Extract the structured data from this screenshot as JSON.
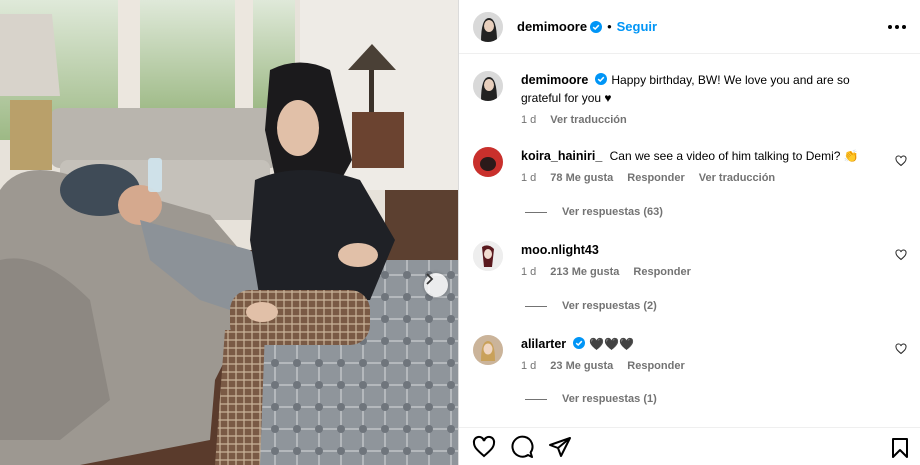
{
  "post": {
    "author": "demimoore",
    "follow_label": "Seguir",
    "separator": "•",
    "caption_text": "Happy birthday, BW! We love you and are so grateful for you ♥",
    "caption_time": "1 d",
    "caption_translate": "Ver traducción"
  },
  "comments": [
    {
      "user": "koira_hainiri_",
      "verified": false,
      "text": "Can we see a video of him talking to Demi? 👏",
      "time": "1 d",
      "likes": "78 Me gusta",
      "reply": "Responder",
      "translate": "Ver traducción",
      "replies": "Ver respuestas (63)"
    },
    {
      "user": "moo.nlight43",
      "verified": false,
      "text": "",
      "time": "1 d",
      "likes": "213 Me gusta",
      "reply": "Responder",
      "replies": "Ver respuestas (2)"
    },
    {
      "user": "alilarter",
      "verified": true,
      "text": "🖤🖤🖤",
      "time": "1 d",
      "likes": "23 Me gusta",
      "reply": "Responder",
      "replies": "Ver respuestas (1)"
    }
  ],
  "icons": {
    "more": "more-options-icon",
    "like": "heart-icon",
    "comment": "comment-bubble-icon",
    "share": "share-plane-icon",
    "save": "bookmark-icon",
    "next": "chevron-right-icon",
    "verified": "verified-badge-icon"
  },
  "colors": {
    "accent": "#0095f6",
    "verified": "#0095f6",
    "muted": "#737373"
  }
}
